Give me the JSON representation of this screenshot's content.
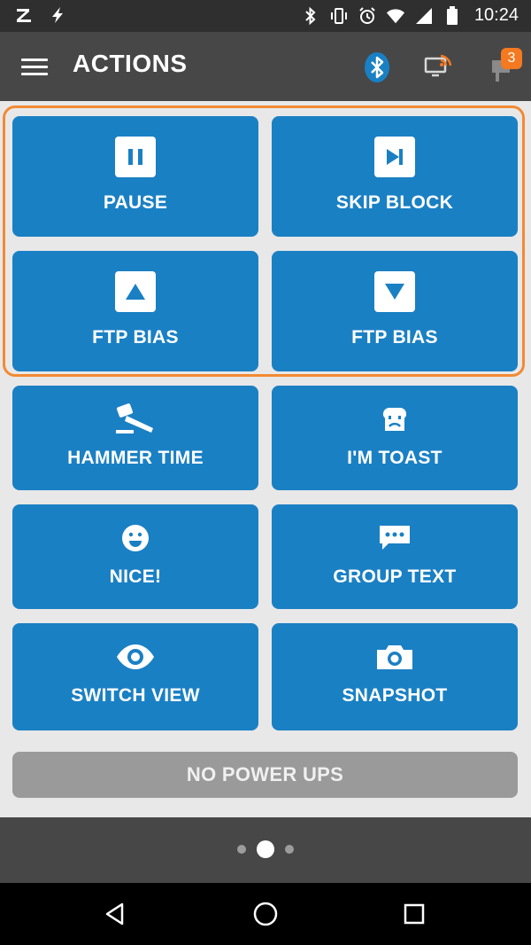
{
  "status_bar": {
    "time": "10:24",
    "icons": [
      "z-app-icon",
      "lightning-icon",
      "bluetooth-icon",
      "vibrate-icon",
      "alarm-icon",
      "wifi-icon",
      "signal-icon",
      "battery-icon"
    ]
  },
  "app_bar": {
    "title": "ACTIONS",
    "notification_count": "3",
    "colors": {
      "bluetooth": "#1a80c4",
      "cast_accent": "#f47920",
      "badge": "#f47920"
    }
  },
  "actions": [
    {
      "label": "PAUSE",
      "icon": "pause-icon"
    },
    {
      "label": "SKIP BLOCK",
      "icon": "skip-block-icon"
    },
    {
      "label": "FTP BIAS",
      "icon": "ftp-bias-up-icon"
    },
    {
      "label": "FTP BIAS",
      "icon": "ftp-bias-down-icon"
    },
    {
      "label": "HAMMER TIME",
      "icon": "hammer-icon"
    },
    {
      "label": "I'M TOAST",
      "icon": "toast-icon"
    },
    {
      "label": "NICE!",
      "icon": "smiley-icon"
    },
    {
      "label": "GROUP TEXT",
      "icon": "chat-bubble-icon"
    },
    {
      "label": "SWITCH VIEW",
      "icon": "eye-icon"
    },
    {
      "label": "SNAPSHOT",
      "icon": "camera-icon"
    }
  ],
  "power_ups": {
    "label": "NO POWER UPS"
  },
  "pager": {
    "pages": 3,
    "current": 2
  },
  "colors": {
    "tile": "#1a80c4",
    "highlight": "#f28a33",
    "disabled": "#9a9a9a"
  }
}
